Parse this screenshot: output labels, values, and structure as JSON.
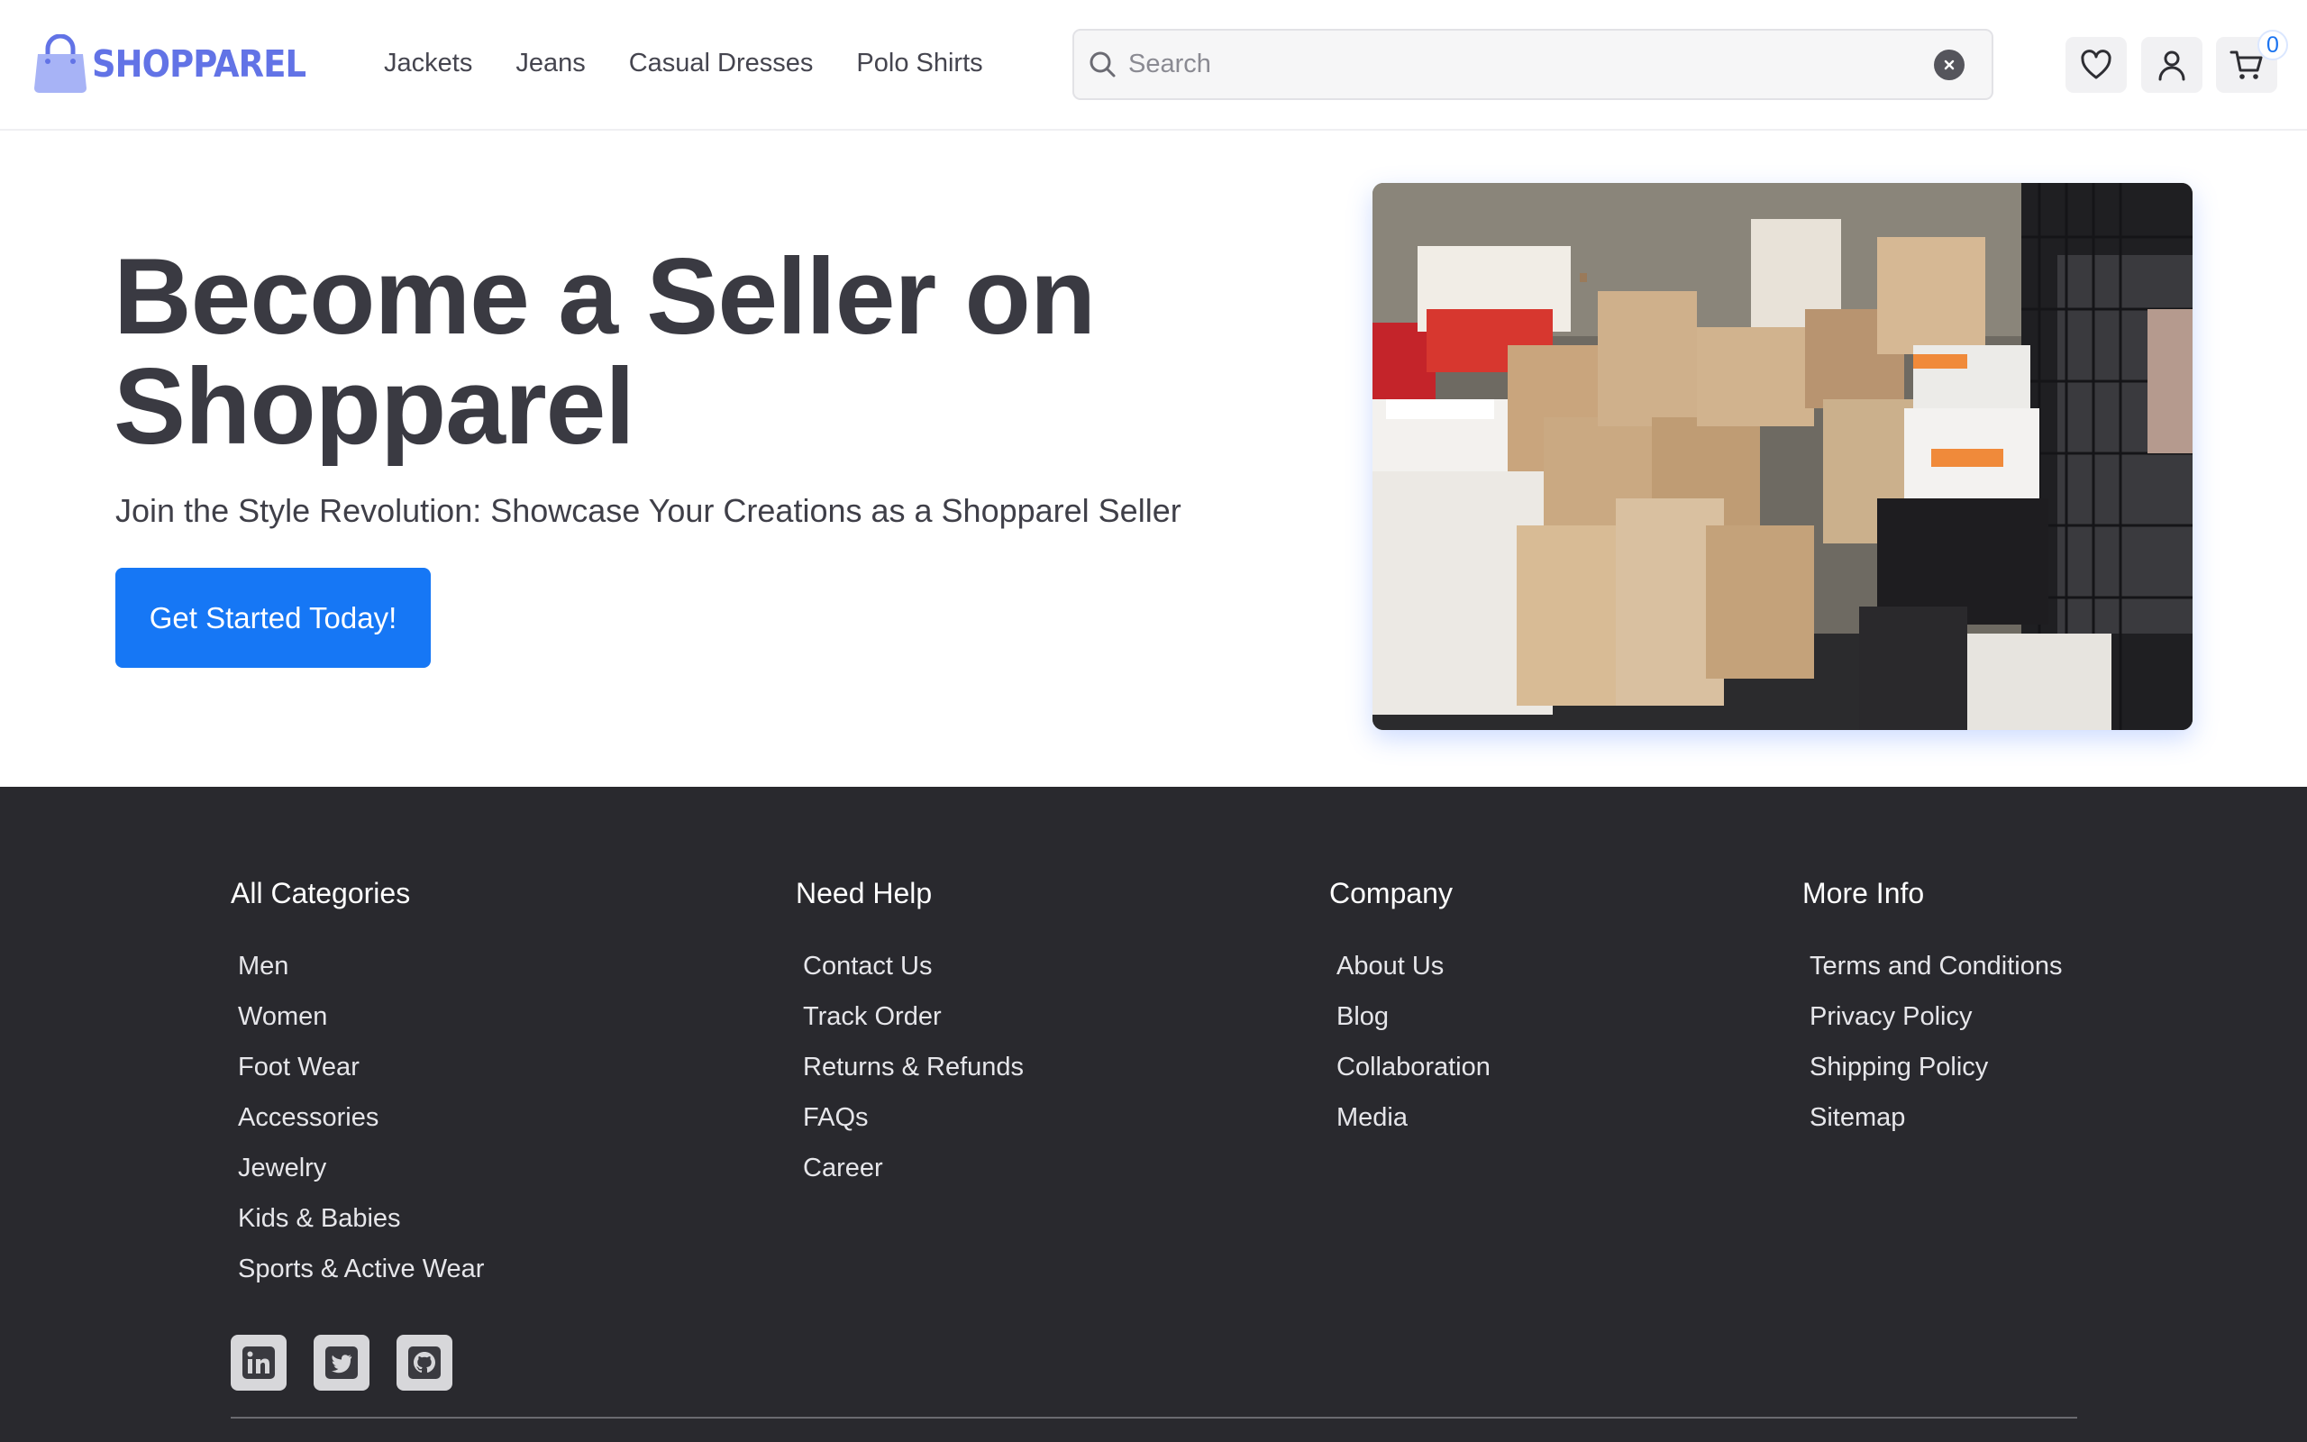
{
  "brand": {
    "name": "SHOPPAREL",
    "color": "#6273e6"
  },
  "nav": {
    "items": [
      "Jackets",
      "Jeans",
      "Casual Dresses",
      "Polo Shirts"
    ]
  },
  "search": {
    "placeholder": "Search",
    "value": ""
  },
  "header_icons": {
    "wishlist": "heart-icon",
    "account": "user-icon",
    "cart": "cart-icon",
    "cart_count": "0"
  },
  "hero": {
    "title": "Become a Seller on Shopparel",
    "subtitle": "Join the Style Revolution: Showcase Your Creations as a Shopparel Seller",
    "cta_label": "Get Started Today!",
    "accent_color": "#1677f5"
  },
  "footer": {
    "columns": [
      {
        "heading": "All Categories",
        "links": [
          "Men",
          "Women",
          "Foot Wear",
          "Accessories",
          "Jewelry",
          "Kids & Babies",
          "Sports & Active Wear"
        ]
      },
      {
        "heading": "Need Help",
        "links": [
          "Contact Us",
          "Track Order",
          "Returns & Refunds",
          "FAQs",
          "Career"
        ]
      },
      {
        "heading": "Company",
        "links": [
          "About Us",
          "Blog",
          "Collaboration",
          "Media"
        ]
      },
      {
        "heading": "More Info",
        "links": [
          "Terms and Conditions",
          "Privacy Policy",
          "Shipping Policy",
          "Sitemap"
        ]
      }
    ],
    "social": [
      "linkedin-icon",
      "twitter-icon",
      "github-icon"
    ],
    "background_color": "#29292e"
  }
}
